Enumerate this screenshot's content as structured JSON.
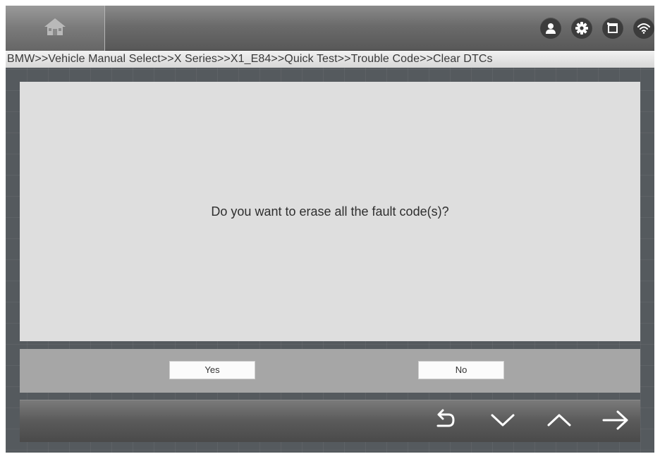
{
  "header": {
    "home_icon": "home-icon",
    "status_icons": [
      "user-icon",
      "gear-icon",
      "window-icon",
      "wifi-icon"
    ]
  },
  "breadcrumb": {
    "path": "BMW>>Vehicle Manual Select>>X Series>>X1_E84>>Quick Test>>Trouble Code>>Clear DTCs"
  },
  "dialog": {
    "message": "Do you want to erase all the fault code(s)?",
    "yes_label": "Yes",
    "no_label": "No"
  },
  "toolbar": {
    "buttons": [
      "back-icon",
      "chevron-down-icon",
      "chevron-up-icon",
      "arrow-right-icon"
    ]
  },
  "colors": {
    "background": "#555a5e",
    "panel": "#dedede",
    "button_bar": "#a6a6a6"
  }
}
